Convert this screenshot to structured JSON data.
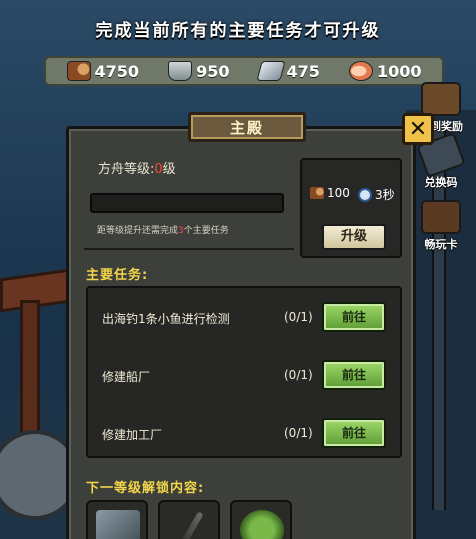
{
  "top_title": "完成当前所有的主要任务才可升级",
  "resources": [
    {
      "icon": "wood-log-icon",
      "value": "4750"
    },
    {
      "icon": "tin-can-icon",
      "value": "950"
    },
    {
      "icon": "iron-ingot-icon",
      "value": "475"
    },
    {
      "icon": "fish-meat-icon",
      "value": "1000"
    }
  ],
  "side_buttons": {
    "sign_in": "签到奖励",
    "redeem_code": "兑换码",
    "card": "畅玩卡"
  },
  "panel": {
    "title": "主殿",
    "close_label": "✕",
    "level_prefix": "方舟等级:",
    "level_value": "0",
    "level_suffix": "级",
    "level_progress": 0,
    "hint_prefix": "距等级提升还需完成",
    "hint_count": "3",
    "hint_suffix": "个主要任务",
    "cost_wood": "100",
    "cost_time": "3秒",
    "upgrade_label": "升级",
    "tasks_header": "主要任务:",
    "tasks": [
      {
        "name": "出海钓1条小鱼进行检测",
        "progress": "(0/1)",
        "button": "前往"
      },
      {
        "name": "修建船厂",
        "progress": "(0/1)",
        "button": "前往"
      },
      {
        "name": "修建加工厂",
        "progress": "(0/1)",
        "button": "前往"
      }
    ],
    "unlock_header": "下一等级解锁内容:"
  }
}
